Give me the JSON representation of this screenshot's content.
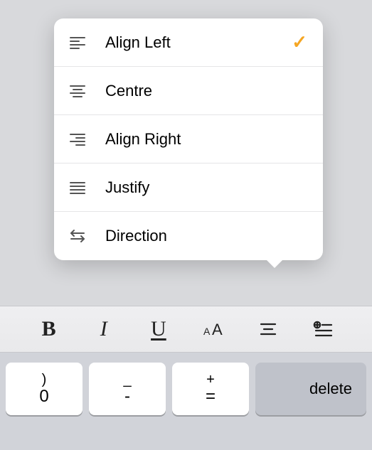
{
  "menu": {
    "items": [
      {
        "label": "Align Left",
        "icon": "align-left-icon",
        "selected": true
      },
      {
        "label": "Centre",
        "icon": "align-center-icon",
        "selected": false
      },
      {
        "label": "Align Right",
        "icon": "align-right-icon",
        "selected": false
      },
      {
        "label": "Justify",
        "icon": "justify-icon",
        "selected": false
      },
      {
        "label": "Direction",
        "icon": "direction-icon",
        "selected": false
      }
    ],
    "checkmark": "✓"
  },
  "toolbar": {
    "bold_label": "B",
    "italic_label": "I",
    "underline_label": "U"
  },
  "keyboard": {
    "key0_top": ")",
    "key0_bot": "0",
    "key1_top": "_",
    "key1_bot": "-",
    "key2_top": "+",
    "key2_bot": "=",
    "delete_label": "delete"
  },
  "colors": {
    "accent": "#f5a623"
  }
}
